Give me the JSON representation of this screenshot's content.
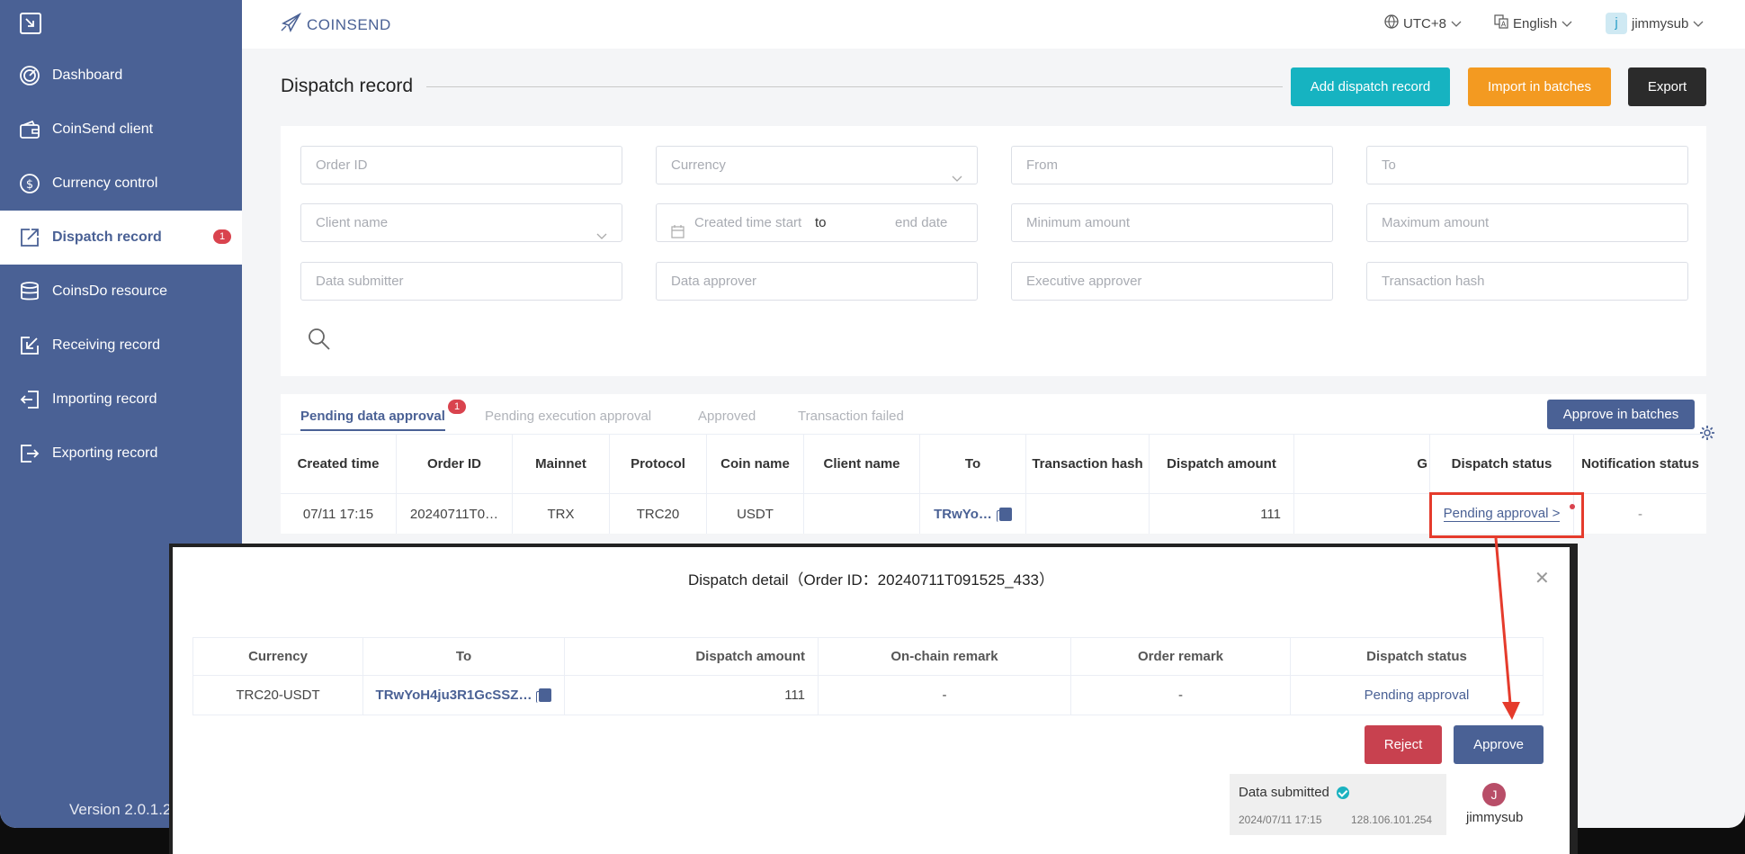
{
  "header": {
    "logo": "COINSEND",
    "timezone": "UTC+8",
    "language": "English",
    "user_initial": "j",
    "username": "jimmysub"
  },
  "sidebar": {
    "items": [
      {
        "label": "Dashboard",
        "icon": "dashboard-icon"
      },
      {
        "label": "CoinSend client",
        "icon": "wallet-icon"
      },
      {
        "label": "Currency control",
        "icon": "dollar-icon"
      },
      {
        "label": "Dispatch record",
        "icon": "dispatch-icon",
        "badge": "1"
      },
      {
        "label": "CoinsDo resource",
        "icon": "database-icon"
      },
      {
        "label": "Receiving record",
        "icon": "receive-icon"
      },
      {
        "label": "Importing record",
        "icon": "import-icon"
      },
      {
        "label": "Exporting record",
        "icon": "export-icon"
      }
    ],
    "version": "Version 2.0.1.2"
  },
  "page": {
    "title": "Dispatch record",
    "add_label": "Add dispatch record",
    "import_label": "Import in batches",
    "export_label": "Export"
  },
  "filters": {
    "order_id": "Order ID",
    "currency": "Currency",
    "from": "From",
    "to": "To",
    "client_name": "Client name",
    "created_start": "Created time start",
    "range_sep": "to",
    "end_date": "end date",
    "min_amount": "Minimum amount",
    "max_amount": "Maximum amount",
    "data_submitter": "Data submitter",
    "data_approver": "Data approver",
    "executive_approver": "Executive approver",
    "tx_hash": "Transaction hash"
  },
  "tabs": [
    {
      "label": "Pending data approval",
      "badge": "1"
    },
    {
      "label": "Pending execution approval"
    },
    {
      "label": "Approved"
    },
    {
      "label": "Transaction failed"
    }
  ],
  "approve_batches_label": "Approve in batches",
  "table": {
    "headers": [
      "Created time",
      "Order ID",
      "Mainnet",
      "Protocol",
      "Coin name",
      "Client name",
      "To",
      "Transaction hash",
      "Dispatch amount",
      "G",
      "Dispatch status",
      "Notification status"
    ],
    "row": {
      "created": "07/11 17:15",
      "order_id": "20240711T0…",
      "mainnet": "TRX",
      "protocol": "TRC20",
      "coin": "USDT",
      "client": "",
      "to": "TRwYo…",
      "tx_hash": "",
      "amount": "111",
      "g": "",
      "status": "Pending approval >",
      "notification": "-"
    }
  },
  "modal": {
    "title": "Dispatch detail（Order ID：20240711T091525_433）",
    "headers": [
      "Currency",
      "To",
      "Dispatch amount",
      "On-chain remark",
      "Order remark",
      "Dispatch status"
    ],
    "row": {
      "currency": "TRC20-USDT",
      "to": "TRwYoH4ju3R1GcSSZ…",
      "amount": "111",
      "chain_remark": "-",
      "order_remark": "-",
      "status": "Pending approval"
    },
    "reject_label": "Reject",
    "approve_label": "Approve",
    "timeline": {
      "title": "Data submitted",
      "time": "2024/07/11 17:15",
      "ip": "128.106.101.254",
      "avatar": "J",
      "user": "jimmysub"
    }
  },
  "colors": {
    "sidebar": "#4a6195",
    "teal": "#16b3c1",
    "orange": "#f39a21",
    "dark": "#2b2b2b",
    "reject": "#c8414f",
    "highlight": "#e53b2c"
  }
}
